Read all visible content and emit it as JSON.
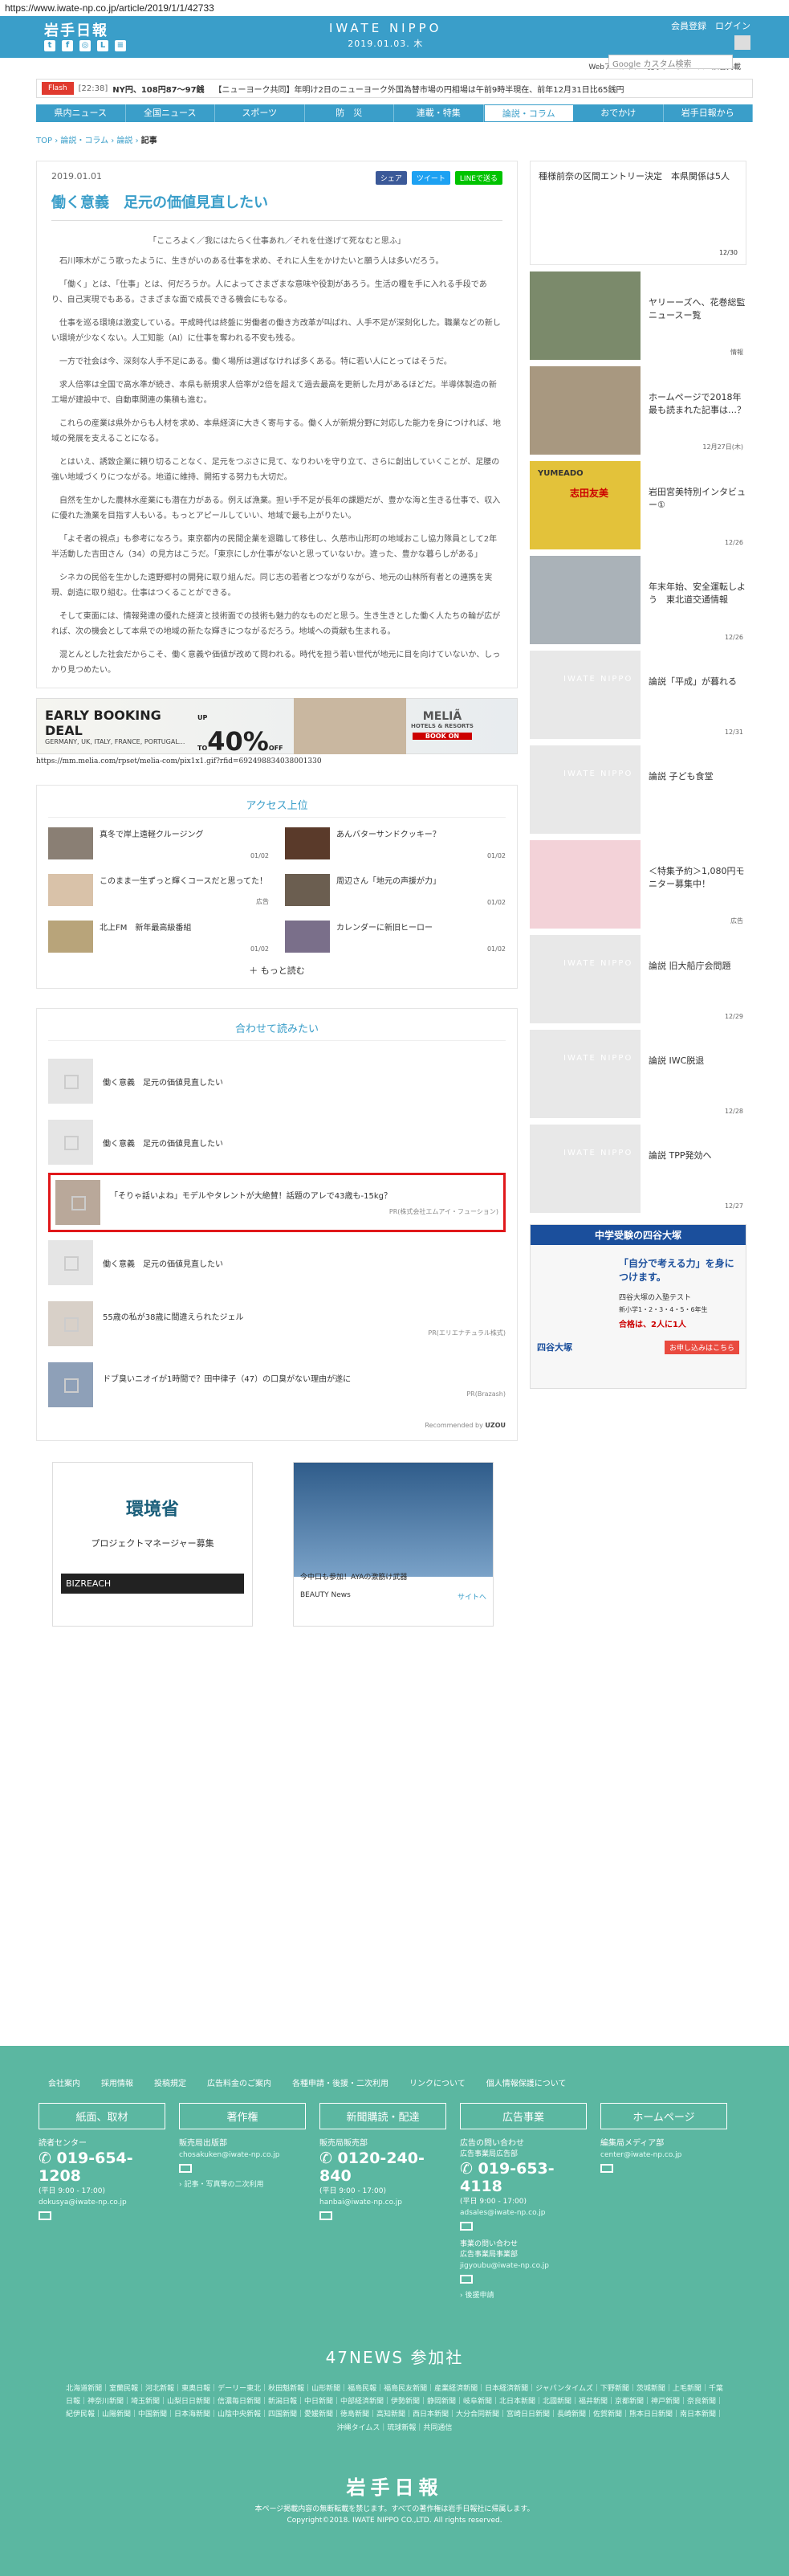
{
  "url": "https://www.iwate-np.co.jp/article/2019/1/1/42733",
  "header": {
    "logo": "岩手日報",
    "center_title": "IWATE NIPPO",
    "date": "2019.01.03. 木",
    "auth": "会員登録　ログイン",
    "search_placeholder": "Google カスタム検索",
    "sublinks": "Webアーカイブ　記事データベース　広告掲載"
  },
  "ticker": {
    "flash": "Flash",
    "time": "[22:38]",
    "item1": "NY円、108円87～97銭",
    "item2": "【ニューヨーク共同】年明け2日のニューヨーク外国為替市場の円相場は午前9時半現在、前年12月31日比65銭円"
  },
  "nav": [
    "県内ニュース",
    "全国ニュース",
    "スポーツ",
    "防　災",
    "連載・特集",
    "論説・コラム",
    "おでかけ",
    "岩手日報から"
  ],
  "breadcrumb": {
    "items": [
      "TOP",
      "論説・コラム",
      "論説"
    ],
    "current": "記事"
  },
  "article": {
    "date": "2019.01.01",
    "share": [
      "シェア",
      "ツイート",
      "LINEで送る"
    ],
    "title": "働く意義　足元の価値見直したい",
    "lead": "「こころよく／我にはたらく仕事あれ／それを仕遂げて死なむと思ふ」",
    "paragraphs": [
      "石川啄木がこう歌ったように、生きがいのある仕事を求め、それに人生をかけたいと願う人は多いだろう。",
      "「働く」とは、「仕事」とは、何だろうか。人によってさまざまな意味や役割があろう。生活の糧を手に入れる手段であり、自己実現でもある。さまざまな面で成長できる機会にもなる。",
      "仕事を巡る環境は激変している。平成時代は終盤に労働者の働き方改革が叫ばれ、人手不足が深刻化した。職業などの新しい環境が少なくない。人工知能（AI）に仕事を奪われる不安も残る。",
      "一方で社会は今、深刻な人手不足にある。働く場所は選ばなければ多くある。特に若い人にとってはそうだ。",
      "求人倍率は全国で高水準が続き、本県も新規求人倍率が2倍を超えて過去最高を更新した月があるほどだ。半導体製造の新工場が建設中で、自動車関連の集積も進む。",
      "これらの産業は県外からも人材を求め、本県経済に大きく寄与する。働く人が新規分野に対応した能力を身につければ、地域の発展を支えることになる。",
      "とはいえ、誘致企業に頼り切ることなく、足元をつぶさに見て、なりわいを守り立て、さらに創出していくことが、足腰の強い地域づくりにつながる。地道に維持、開拓する努力も大切だ。",
      "自然を生かした農林水産業にも潜在力がある。例えば漁業。担い手不足が長年の課題だが、豊かな海と生きる仕事で、収入に優れた漁業を目指す人もいる。もっとアピールしていい、地域で最も上がりたい。",
      "「よそ者の視点」も参考になろう。東京都内の民間企業を退職して移住し、久慈市山形町の地域おこし協力隊員として2年半活動した吉田さん（34）の見方はこうだ。「東京にしか仕事がないと思っていないか。違った、豊かな暮らしがある」",
      "シネカの民俗を生かした遠野郷村の開発に取り組んだ。同じ志の若者とつながりながら、地元の山林所有者との連携を実現、創造に取り組む。仕事はつくることができる。",
      "そして東面には、情報発達の優れた経済と技術面での技術も魅力的なものだと思う。生き生きとした働く人たちの輪が広がれば、次の機会として本県での地域の新たな輝きにつながるだろう。地域への貢献も生まれる。",
      "混とんとした社会だからこそ、働く意義や価値が改めて問われる。時代を担う若い世代が地元に目を向けていないか、しっかり見つめたい。"
    ]
  },
  "ad1": {
    "title": "EARLY BOOKING DEAL",
    "upto": "UP TO",
    "pct": "40%",
    "off": "OFF",
    "countries": "GERMANY, UK, ITALY, FRANCE, PORTUGAL...",
    "brand": "MELIÃ",
    "brand_sub": "HOTELS & RESORTS",
    "book": "BOOK ON",
    "url": "https://mm.melia.com/rpset/melia-com/pix1x1.gif?rfid=692498834038001330"
  },
  "access": {
    "heading": "アクセス上位",
    "items": [
      {
        "t": "真冬で岸上遠軽クルージング",
        "d": "01/02"
      },
      {
        "t": "あんバターサンドクッキー？",
        "d": "01/02"
      },
      {
        "t": "このまま一生ずっと輝くコースだと思ってた！",
        "d": "01/02",
        "ad": "広告"
      },
      {
        "t": "周辺さん「地元の声援が力」",
        "d": "01/02"
      },
      {
        "t": "北上FM　新年最高級番組",
        "d": "01/02"
      },
      {
        "t": "カレンダーに新旧ヒーロー",
        "d": "01/02"
      }
    ],
    "more": "もっと読む"
  },
  "related": {
    "heading": "合わせて読みたい",
    "items": [
      {
        "t": "働く意義　足元の価値見直したい"
      },
      {
        "t": "働く意義　足元の価値見直したい"
      },
      {
        "t": "「そりゃ話いよね」モデルやタレントが大絶賛！話題のアレで43歳も-15kg？",
        "pr": "PR(株式会社エムアイ・フューション)"
      },
      {
        "t": "働く意義　足元の価値見直したい"
      },
      {
        "t": "55歳の私が38歳に間違えられたジェル",
        "pr": "PR(エリエナチュラル株式)"
      },
      {
        "t": "ドブ臭いニオイが1時間で？田中律子（47）の口臭がない理由が遂に",
        "pr": "PR(Brazash)"
      }
    ],
    "recommended": "Recommended by"
  },
  "bottom_ads": {
    "a1_title": "環境省",
    "a1_sub": "プロジェクトマネージャー募集",
    "a1_brand": "BIZREACH",
    "a2_caption": "今中口も参加！AYAの激筋け武器",
    "a2_brand": "BEAUTY News",
    "a2_site": "サイトへ"
  },
  "sidebar": {
    "top": {
      "t": "種様前奈の区間エントリー決定　本県関係は5人",
      "d": "12/30"
    },
    "items": [
      {
        "t": "ヤリーーズへ、花巻総監ニュースー覧",
        "d": "",
        "src": "情報"
      },
      {
        "t": "ホームページで2018年最も読まれた記事は…？",
        "d": "12月27日(木)"
      },
      {
        "t": "岩田宮美特別インタビュー①",
        "d": "12/26",
        "ad_label": "YUMEADO",
        "ad_sub": "志田友美"
      },
      {
        "t": "年末年始、安全運転しよう　東北道交通情報",
        "d": "12/26"
      },
      {
        "t": "論説「平成」が暮れる",
        "d": "12/31",
        "logo": "IWATE NIPPO"
      },
      {
        "t": "論説 子ども食堂",
        "d": "",
        "logo": "IWATE NIPPO"
      },
      {
        "t": "＜特集予約＞1,080円モニター募集中！",
        "d": "広告"
      },
      {
        "t": "論説 旧大船庁会問題",
        "d": "12/29",
        "logo": "IWATE NIPPO"
      },
      {
        "t": "論説 IWC脱退",
        "d": "12/28",
        "logo": "IWATE NIPPO"
      },
      {
        "t": "論説 TPP発効へ",
        "d": "12/27",
        "logo": "IWATE NIPPO"
      }
    ],
    "ad": {
      "title": "中学受験の四谷大塚",
      "tag": "「自分で考える力」を身につけます。",
      "sub": "四谷大塚の入塾テスト",
      "grades": "新小学1・2・3・4・5・6年生",
      "pass": "合格は、2人に1人",
      "btn": "お申し込みはこちら",
      "brand": "四谷大塚"
    }
  },
  "footer": {
    "links": [
      "会社案内",
      "採用情報",
      "投稿規定",
      "広告料金のご案内",
      "各種申請・後援・二次利用",
      "リンクについて",
      "個人情報保護について"
    ],
    "cols": [
      {
        "hd": "紙面、取材",
        "l1": "読者センター",
        "ph": "019-654-1208",
        "sm": "(平日 9:00 - 17:00)",
        "mail": "dokusya@iwate-np.co.jp"
      },
      {
        "hd": "著作権",
        "l1": "販売局出版部",
        "mail": "chosakuken@iwate-np.co.jp",
        "link": "記事・写真等の二次利用"
      },
      {
        "hd": "新聞購読・配達",
        "l1": "販売局販売部",
        "ph": "0120-240-840",
        "sm": "(平日 9:00 - 17:00)",
        "mail": "hanbai@iwate-np.co.jp"
      },
      {
        "hd": "広告事業",
        "l1": "広告の問い合わせ",
        "l2": "広告事業局広告部",
        "ph": "019-653-4118",
        "sm": "(平日 9:00 - 17:00)",
        "mail": "adsales@iwate-np.co.jp",
        "l3": "事業の問い合わせ",
        "l4": "広告事業局事業部",
        "mail2": "jigyoubu@iwate-np.co.jp",
        "link": "後援申請"
      },
      {
        "hd": "ホームページ",
        "l1": "編集局メディア部",
        "mail": "center@iwate-np.co.jp"
      }
    ],
    "n47": "47NEWS 参加社",
    "papers": "北海道新聞｜室蘭民報｜河北新報｜東奥日報｜デーリー東北｜秋田魁新報｜山形新聞｜福島民報｜福島民友新聞｜産業経済新聞｜日本経済新聞｜ジャパンタイムズ｜下野新聞｜茨城新聞｜上毛新聞｜千葉日報｜神奈川新聞｜埼玉新聞｜山梨日日新聞｜信濃毎日新聞｜新潟日報｜中日新聞｜中部経済新聞｜伊勢新聞｜静岡新聞｜岐阜新聞｜北日本新聞｜北國新聞｜福井新聞｜京都新聞｜神戸新聞｜奈良新聞｜紀伊民報｜山陽新聞｜中国新聞｜日本海新聞｜山陰中央新報｜四国新聞｜愛媛新聞｜徳島新聞｜高知新聞｜西日本新聞｜大分合同新聞｜宮崎日日新聞｜長崎新聞｜佐賀新聞｜熊本日日新聞｜南日本新聞｜沖縄タイムス｜琉球新報｜共同通信",
    "logo": "岩手日報",
    "notice": "本ページ掲載内容の無断転載を禁じます。すべての著作権は岩手日報社に帰属します。",
    "copy": "Copyright©2018. IWATE NIPPO CO.,LTD. All rights reserved."
  }
}
